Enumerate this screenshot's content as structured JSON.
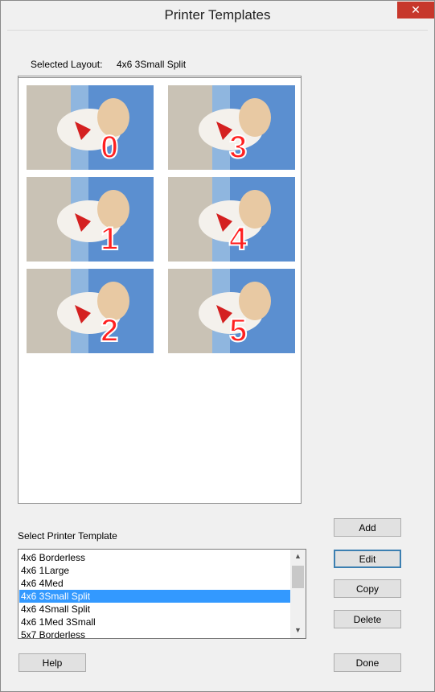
{
  "window": {
    "title": "Printer Templates",
    "close_glyph": "✕"
  },
  "selected_layout": {
    "label": "Selected Layout:",
    "value": "4x6 3Small Split"
  },
  "preview": {
    "tiles": [
      {
        "number": "0"
      },
      {
        "number": "1"
      },
      {
        "number": "2"
      },
      {
        "number": "3"
      },
      {
        "number": "4"
      },
      {
        "number": "5"
      }
    ]
  },
  "template_list": {
    "label": "Select Printer Template",
    "items": [
      "4x6 Borderless",
      "4x6 1Large",
      "4x6 4Med",
      "4x6 3Small Split",
      "4x6 4Small Split",
      "4x6 1Med 3Small",
      "5x7 Borderless"
    ],
    "selected": "4x6 3Small Split"
  },
  "buttons": {
    "add": "Add",
    "edit": "Edit",
    "copy": "Copy",
    "delete": "Delete",
    "help": "Help",
    "done": "Done"
  },
  "colors": {
    "number_fill": "#ff2020",
    "selection": "#3399ff"
  }
}
